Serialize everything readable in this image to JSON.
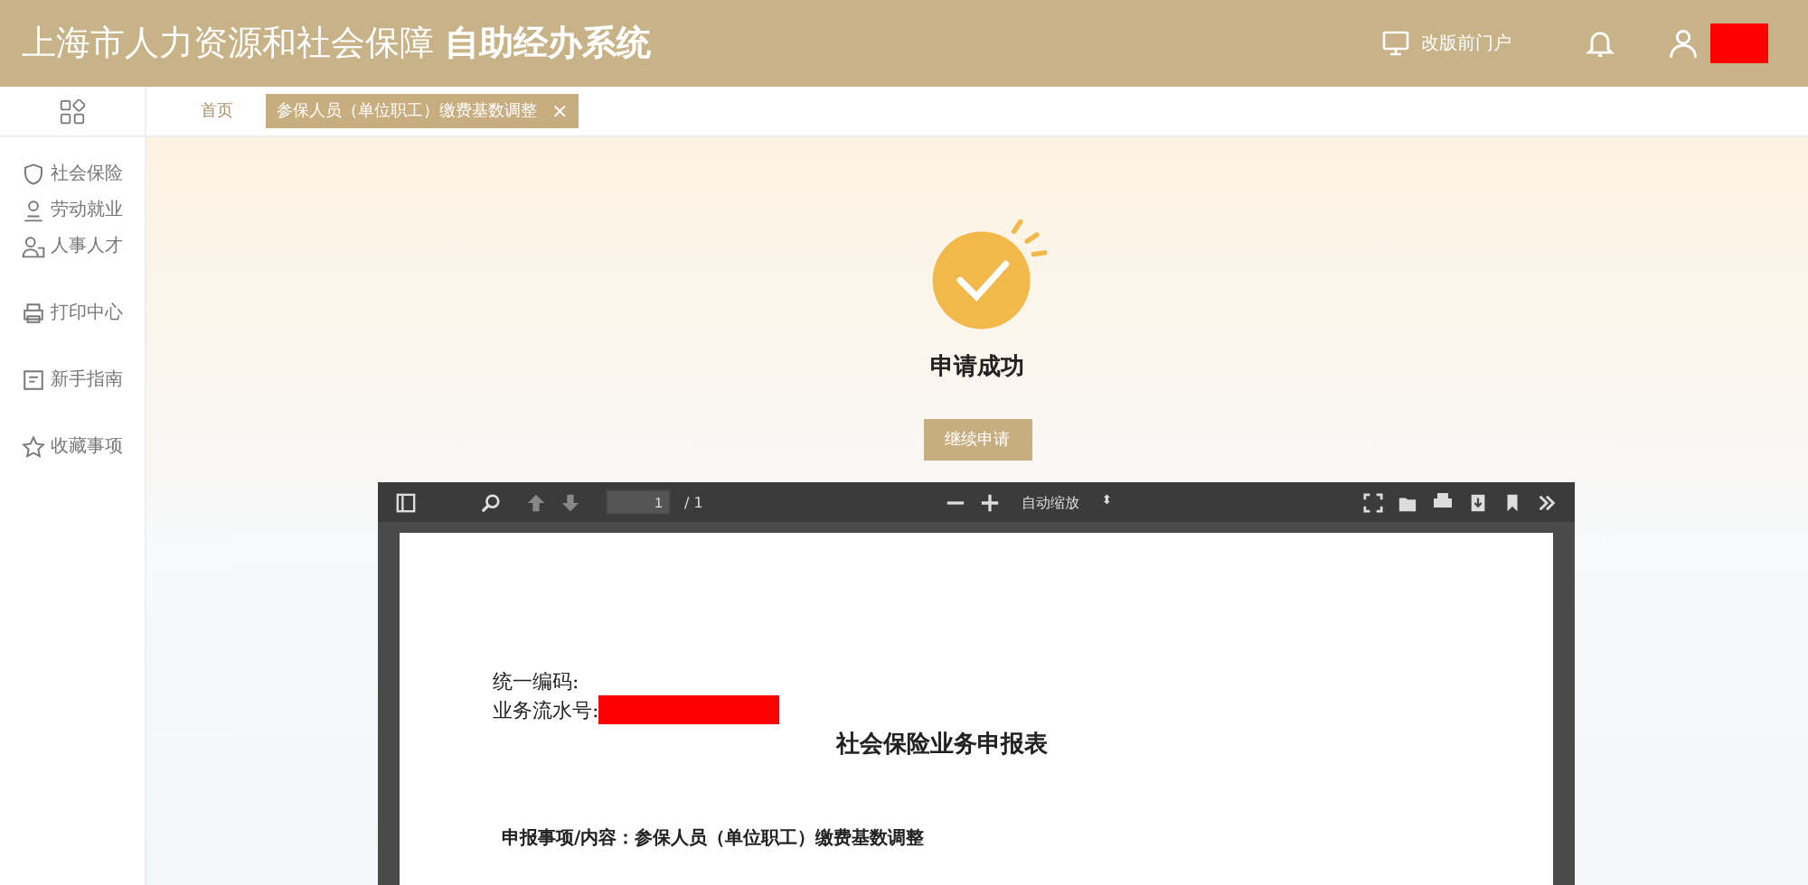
{
  "header": {
    "title": "上海市人力资源和社会保障",
    "title_bold": "自助经办系统",
    "portal_link": "改版前门户"
  },
  "tabs": [
    {
      "label": "首页",
      "selected": false,
      "closable": false
    },
    {
      "label": "参保人员（单位职工）缴费基数调整",
      "selected": true,
      "closable": true
    }
  ],
  "close_glyph": "×",
  "sidebar": {
    "items": [
      {
        "label": "社会保险"
      },
      {
        "label": "劳动就业"
      },
      {
        "label": "人事人才"
      },
      {
        "label": "打印中心"
      },
      {
        "label": "新手指南"
      },
      {
        "label": "收藏事项"
      }
    ]
  },
  "result": {
    "message": "申请成功",
    "button": "继续申请"
  },
  "pdf_viewer": {
    "page_number": "1",
    "page_total": "/ 1",
    "zoom": "自动缩放",
    "zoom_caret": "⬍",
    "document": {
      "code_label": "统一编码:",
      "serial_label": "业务流水号:",
      "title": "社会保险业务申报表",
      "item_line": "申报事项/内容：参保人员（单位职工）缴费基数调整"
    }
  }
}
